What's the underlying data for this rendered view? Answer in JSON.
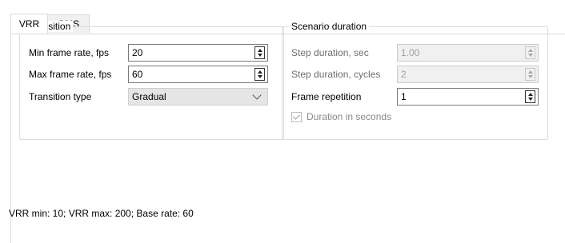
{
  "tabs": [
    {
      "label": "VRR",
      "active": true
    },
    {
      "label": "QMS",
      "active": false
    }
  ],
  "transition": {
    "title": "Transition",
    "min_frame_rate": {
      "label": "Min frame rate, fps",
      "value": "20"
    },
    "max_frame_rate": {
      "label": "Max frame rate, fps",
      "value": "60"
    },
    "transition_type": {
      "label": "Transition type",
      "value": "Gradual"
    }
  },
  "scenario": {
    "title": "Scenario duration",
    "step_duration_sec": {
      "label": "Step duration, sec",
      "value": "1.00",
      "enabled": false
    },
    "step_duration_cycles": {
      "label": "Step duration, cycles",
      "value": "2",
      "enabled": false
    },
    "frame_repetition": {
      "label": "Frame repetition",
      "value": "1",
      "enabled": true
    },
    "duration_in_seconds": {
      "label": "Duration in seconds",
      "checked": true,
      "enabled": false
    }
  },
  "status_text": "VRR min: 10; VRR max: 200;  Base rate: 60"
}
